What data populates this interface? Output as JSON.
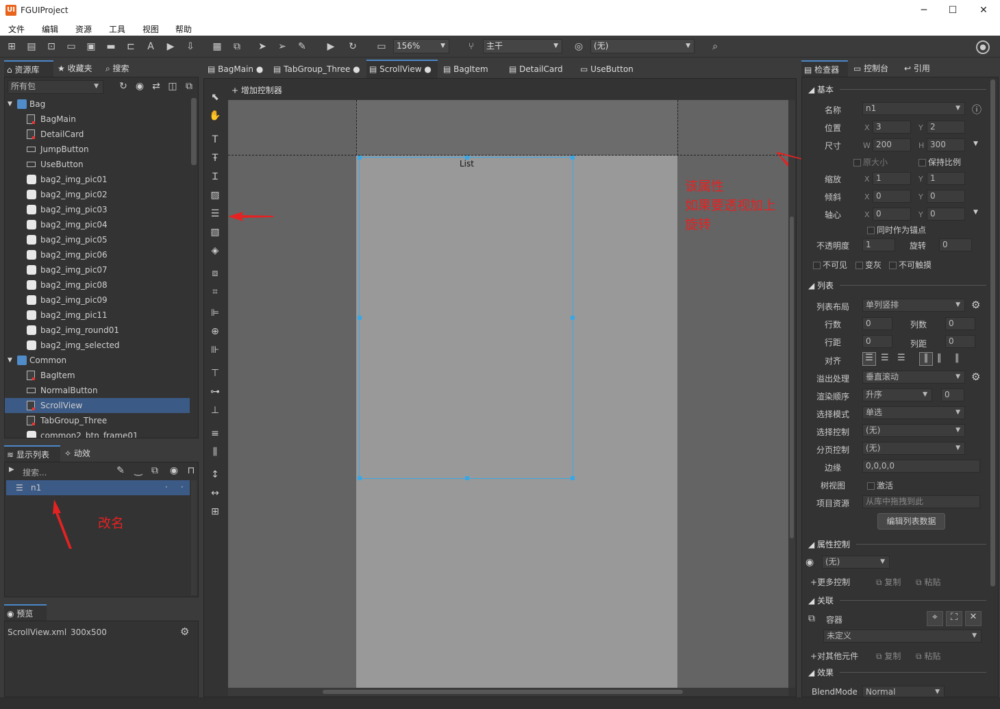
{
  "app": {
    "title": "FGUIProject",
    "logo": "UI"
  },
  "window_controls": {
    "minimize": "─",
    "maximize": "☐",
    "close": "✕"
  },
  "menu": [
    "文件",
    "编辑",
    "资源",
    "工具",
    "视图",
    "帮助"
  ],
  "toolbar": {
    "zoom": "156%",
    "branch": "主干",
    "language": "(无)"
  },
  "library": {
    "tabs": [
      "资源库",
      "收藏夹",
      "搜索"
    ],
    "package_filter": "所有包",
    "items": [
      {
        "label": "Bag",
        "type": "folder",
        "level": 0
      },
      {
        "label": "BagMain",
        "type": "doc",
        "level": 1
      },
      {
        "label": "DetailCard",
        "type": "doc",
        "level": 1
      },
      {
        "label": "JumpButton",
        "type": "button",
        "level": 1
      },
      {
        "label": "UseButton",
        "type": "button",
        "level": 1
      },
      {
        "label": "bag2_img_pic01",
        "type": "img",
        "level": 1
      },
      {
        "label": "bag2_img_pic02",
        "type": "img",
        "level": 1
      },
      {
        "label": "bag2_img_pic03",
        "type": "img",
        "level": 1
      },
      {
        "label": "bag2_img_pic04",
        "type": "img",
        "level": 1
      },
      {
        "label": "bag2_img_pic05",
        "type": "img",
        "level": 1
      },
      {
        "label": "bag2_img_pic06",
        "type": "img",
        "level": 1
      },
      {
        "label": "bag2_img_pic07",
        "type": "img",
        "level": 1
      },
      {
        "label": "bag2_img_pic08",
        "type": "img",
        "level": 1
      },
      {
        "label": "bag2_img_pic09",
        "type": "img",
        "level": 1
      },
      {
        "label": "bag2_img_pic11",
        "type": "img",
        "level": 1
      },
      {
        "label": "bag2_img_round01",
        "type": "img",
        "level": 1
      },
      {
        "label": "bag2_img_selected",
        "type": "img",
        "level": 1
      },
      {
        "label": "Common",
        "type": "folder",
        "level": 0
      },
      {
        "label": "BagItem",
        "type": "doc",
        "level": 1
      },
      {
        "label": "NormalButton",
        "type": "button",
        "level": 1
      },
      {
        "label": "ScrollView",
        "type": "doc",
        "level": 1,
        "selected": true
      },
      {
        "label": "TabGroup_Three",
        "type": "doc",
        "level": 1
      },
      {
        "label": "common2_btn_frame01",
        "type": "img",
        "level": 1
      }
    ]
  },
  "display_list": {
    "tabs": [
      "显示列表",
      "动效"
    ],
    "search_placeholder": "搜索...",
    "items": [
      {
        "label": "n1"
      }
    ],
    "annotation": "改名"
  },
  "preview": {
    "tab": "预览",
    "file": "ScrollView.xml",
    "size": "300x500"
  },
  "editor": {
    "tabs": [
      {
        "label": "BagMain",
        "dirty": true
      },
      {
        "label": "TabGroup_Three",
        "dirty": true
      },
      {
        "label": "ScrollView",
        "dirty": true,
        "active": true
      },
      {
        "label": "BagItem"
      },
      {
        "label": "DetailCard"
      },
      {
        "label": "UseButton"
      }
    ],
    "add_controller": "增加控制器",
    "list_label": "List",
    "annotation_line1": "该属性",
    "annotation_line2": "如果要透视加上旋转"
  },
  "inspector": {
    "tabs": [
      "检查器",
      "控制台",
      "引用"
    ],
    "basic": {
      "section": "基本",
      "name_label": "名称",
      "name": "n1",
      "pos_label": "位置",
      "x": "3",
      "y": "2",
      "size_label": "尺寸",
      "w": "200",
      "h": "300",
      "orig_size": "原大小",
      "keep_ratio": "保持比例",
      "scale_label": "缩放",
      "sx": "1",
      "sy": "1",
      "skew_label": "倾斜",
      "kx": "0",
      "ky": "0",
      "pivot_label": "轴心",
      "px": "0",
      "py": "0",
      "as_anchor": "同时作为锚点",
      "alpha_label": "不透明度",
      "alpha": "1",
      "rot_label": "旋转",
      "rot": "0",
      "invisible": "不可见",
      "gray": "变灰",
      "untouchable": "不可触摸",
      "X": "X",
      "Y": "Y",
      "W": "W",
      "H": "H"
    },
    "list": {
      "section": "列表",
      "layout_label": "列表布局",
      "layout": "单列竖排",
      "rows_label": "行数",
      "rows": "0",
      "cols_label": "列数",
      "cols": "0",
      "rowgap_label": "行距",
      "rowgap": "0",
      "colgap_label": "列距",
      "colgap": "0",
      "align_label": "对齐",
      "overflow_label": "溢出处理",
      "overflow": "垂直滚动",
      "order_label": "渲染顺序",
      "order": "升序",
      "order_val": "0",
      "select_mode_label": "选择模式",
      "select_mode": "单选",
      "select_ctrl_label": "选择控制",
      "select_ctrl": "(无)",
      "page_ctrl_label": "分页控制",
      "page_ctrl": "(无)",
      "margin_label": "边缘",
      "margin": "0,0,0,0",
      "treeview_label": "树视图",
      "treeview": "激活",
      "item_res_label": "项目资源",
      "item_res": "从库中拖拽到此",
      "edit_data": "编辑列表数据"
    },
    "prop_ctrl": {
      "section": "属性控制",
      "value": "(无)",
      "more": "更多控制",
      "copy": "复制",
      "paste": "粘贴"
    },
    "relations": {
      "section": "关联",
      "container": "容器",
      "undefined": "未定义",
      "to_others": "对其他元件",
      "copy": "复制",
      "paste": "粘贴"
    },
    "effects": {
      "section": "效果",
      "blend_label": "BlendMode",
      "blend": "Normal"
    }
  },
  "colors": {
    "accent": "#4c88c9",
    "annotation": "#e52222",
    "selection": "#3c5a86"
  }
}
